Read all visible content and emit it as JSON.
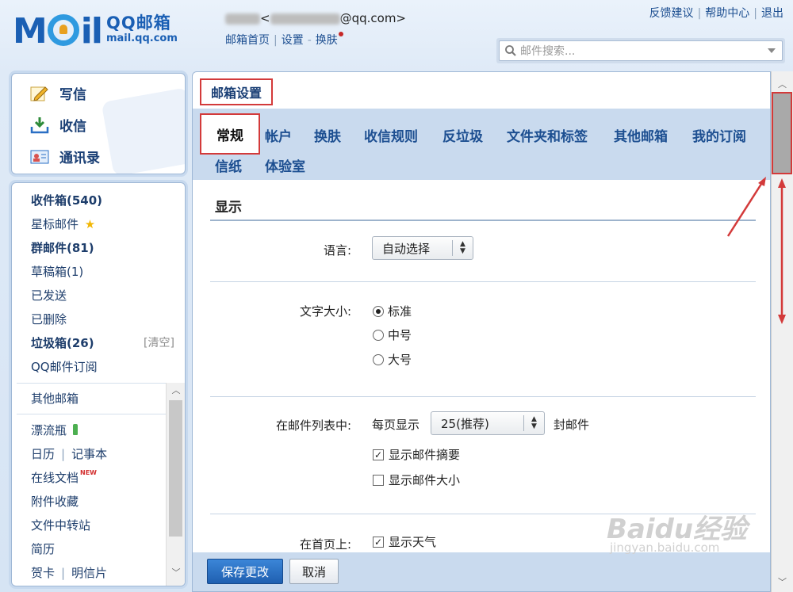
{
  "header": {
    "logo_main": "MAIL",
    "logo_cn": "QQ邮箱",
    "logo_domain": "mail.qq.com",
    "account_prefix": "<",
    "account_suffix": "@qq.com>",
    "nav": [
      "邮箱首页",
      "设置",
      "换肤"
    ],
    "top_links": [
      "反馈建议",
      "帮助中心",
      "退出"
    ],
    "search_placeholder": "邮件搜索..."
  },
  "sidebar": {
    "actions": [
      {
        "label": "写信",
        "icon": "compose-icon"
      },
      {
        "label": "收信",
        "icon": "receive-icon"
      },
      {
        "label": "通讯录",
        "icon": "contacts-icon"
      }
    ],
    "folders": [
      {
        "label": "收件箱(540)",
        "bold": true
      },
      {
        "label": "星标邮件",
        "bold": false
      },
      {
        "label": "群邮件(81)",
        "bold": true
      },
      {
        "label": "草稿箱(1)",
        "bold": false
      },
      {
        "label": "已发送",
        "bold": false
      },
      {
        "label": "已删除",
        "bold": false
      },
      {
        "label": "垃圾箱(26)",
        "bold": true
      },
      {
        "label": "QQ邮件订阅",
        "bold": false
      }
    ],
    "spam_clear": "[清空]",
    "other_items": {
      "other_mailbox": "其他邮箱",
      "drift_bottle": "漂流瓶",
      "calendar": "日历",
      "notepad": "记事本",
      "online_docs": "在线文档",
      "new_badge": "NEW",
      "attachments": "附件收藏",
      "file_transfer": "文件中转站",
      "resume": "简历",
      "greeting_card": "贺卡",
      "postcard": "明信片"
    }
  },
  "main": {
    "title": "邮箱设置",
    "tabs_row1": [
      "常规",
      "帐户",
      "换肤",
      "收信规则",
      "反垃圾",
      "文件夹和标签",
      "其他邮箱",
      "我的订阅"
    ],
    "tabs_row2": [
      "信纸",
      "体验室"
    ],
    "active_tab": "常规",
    "section_title": "显示",
    "language": {
      "label": "语言:",
      "value": "自动选择"
    },
    "font_size": {
      "label": "文字大小:",
      "options": [
        "标准",
        "中号",
        "大号"
      ],
      "selected": "标准"
    },
    "mail_list": {
      "label": "在邮件列表中:",
      "per_page_prefix": "每页显示",
      "per_page_value": "25(推荐)",
      "per_page_suffix": "封邮件",
      "show_summary": {
        "label": "显示邮件摘要",
        "checked": true
      },
      "show_size": {
        "label": "显示邮件大小",
        "checked": false
      }
    },
    "homepage": {
      "label": "在首页上:",
      "show_weather": {
        "label": "显示天气",
        "checked": true
      }
    },
    "save_button": "保存更改",
    "cancel_button": "取消"
  },
  "watermark": {
    "brand": "Baidu经验",
    "url": "jingyan.baidu.com"
  },
  "colors": {
    "accent": "#1d4f91",
    "highlight_box": "#d33a3a",
    "tab_bar": "#c9daee",
    "save_button": "#2a6fc4"
  }
}
